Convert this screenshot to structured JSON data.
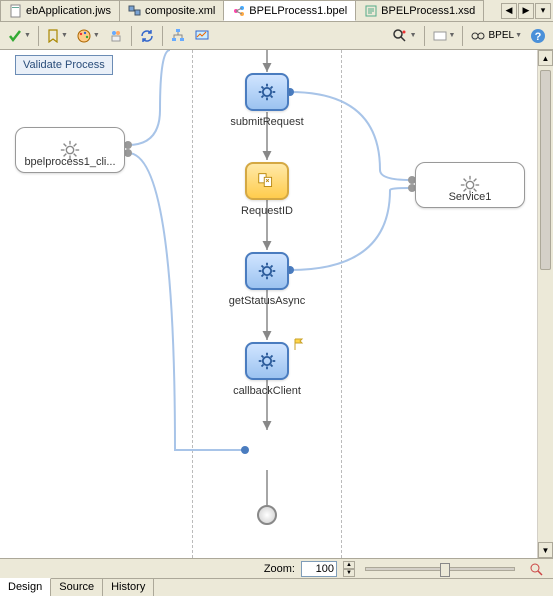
{
  "tabs": {
    "t0": "ebApplication.jws",
    "t1": "composite.xml",
    "t2": "BPELProcess1.bpel",
    "t3": "BPELProcess1.xsd"
  },
  "toolbar": {
    "bpel_label": "BPEL"
  },
  "validate_label": "Validate Process",
  "partners": {
    "left": "bpelprocess1_cli...",
    "right": "Service1"
  },
  "activities": {
    "a1": "submitRequest",
    "a2": "RequestID",
    "a3": "getStatusAsync",
    "a4": "callbackClient"
  },
  "zoom": {
    "label": "Zoom:",
    "value": "100"
  },
  "bottom_tabs": {
    "b0": "Design",
    "b1": "Source",
    "b2": "History"
  }
}
